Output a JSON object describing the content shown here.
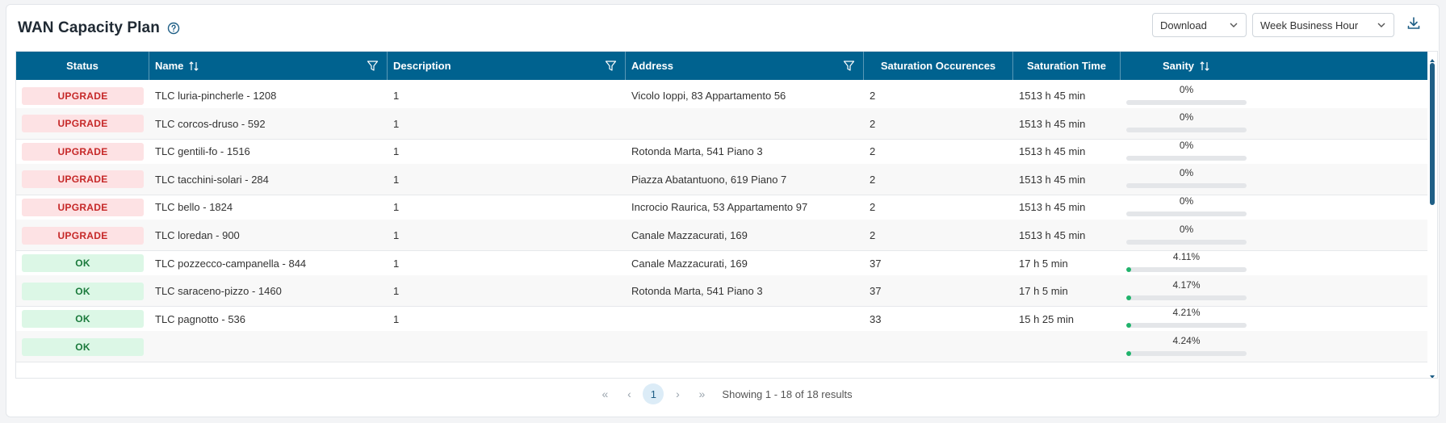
{
  "header": {
    "title": "WAN Capacity Plan",
    "download_label": "Download",
    "period_label": "Week Business Hour"
  },
  "columns": {
    "status": "Status",
    "name": "Name",
    "description": "Description",
    "address": "Address",
    "occurrences": "Saturation Occurences",
    "time": "Saturation Time",
    "sanity": "Sanity"
  },
  "rows": [
    {
      "status": "UPGRADE",
      "status_type": "upgrade",
      "name": "TLC luria-pincherle - 1208",
      "description": "1",
      "address": "Vicolo Ioppi, 83 Appartamento 56",
      "occurrences": "2",
      "time": "1513 h 45 min",
      "sanity": "0%",
      "sanity_value": 0
    },
    {
      "status": "UPGRADE",
      "status_type": "upgrade",
      "name": "TLC corcos-druso - 592",
      "description": "1",
      "address": "",
      "occurrences": "2",
      "time": "1513 h 45 min",
      "sanity": "0%",
      "sanity_value": 0
    },
    {
      "status": "UPGRADE",
      "status_type": "upgrade",
      "name": "TLC gentili-fo - 1516",
      "description": "1",
      "address": "Rotonda Marta, 541 Piano 3",
      "occurrences": "2",
      "time": "1513 h 45 min",
      "sanity": "0%",
      "sanity_value": 0
    },
    {
      "status": "UPGRADE",
      "status_type": "upgrade",
      "name": "TLC tacchini-solari - 284",
      "description": "1",
      "address": "Piazza Abatantuono, 619 Piano 7",
      "occurrences": "2",
      "time": "1513 h 45 min",
      "sanity": "0%",
      "sanity_value": 0
    },
    {
      "status": "UPGRADE",
      "status_type": "upgrade",
      "name": "TLC bello - 1824",
      "description": "1",
      "address": "Incrocio Raurica, 53 Appartamento 97",
      "occurrences": "2",
      "time": "1513 h 45 min",
      "sanity": "0%",
      "sanity_value": 0
    },
    {
      "status": "UPGRADE",
      "status_type": "upgrade",
      "name": "TLC loredan - 900",
      "description": "1",
      "address": "Canale Mazzacurati, 169",
      "occurrences": "2",
      "time": "1513 h 45 min",
      "sanity": "0%",
      "sanity_value": 0
    },
    {
      "status": "OK",
      "status_type": "ok",
      "name": "TLC pozzecco-campanella - 844",
      "description": "1",
      "address": "Canale Mazzacurati, 169",
      "occurrences": "37",
      "time": "17 h 5 min",
      "sanity": "4.11%",
      "sanity_value": 4.11
    },
    {
      "status": "OK",
      "status_type": "ok",
      "name": "TLC saraceno-pizzo - 1460",
      "description": "1",
      "address": "Rotonda Marta, 541 Piano 3",
      "occurrences": "37",
      "time": "17 h 5 min",
      "sanity": "4.17%",
      "sanity_value": 4.17
    },
    {
      "status": "OK",
      "status_type": "ok",
      "name": "TLC pagnotto - 536",
      "description": "1",
      "address": "",
      "occurrences": "33",
      "time": "15 h 25 min",
      "sanity": "4.21%",
      "sanity_value": 4.21
    },
    {
      "status": "OK",
      "status_type": "ok",
      "name": "",
      "description": "",
      "address": "",
      "occurrences": "",
      "time": "",
      "sanity": "4.24%",
      "sanity_value": 4.24
    }
  ],
  "pagination": {
    "current_page": "1",
    "summary": "Showing 1 - 18 of 18 results"
  },
  "colors": {
    "header_bg": "#00628f",
    "upgrade_bg": "#fde2e4",
    "upgrade_text": "#c62828",
    "ok_bg": "#dcf7e6",
    "ok_text": "#1b7a3c",
    "progress_fill": "#20b36b"
  }
}
